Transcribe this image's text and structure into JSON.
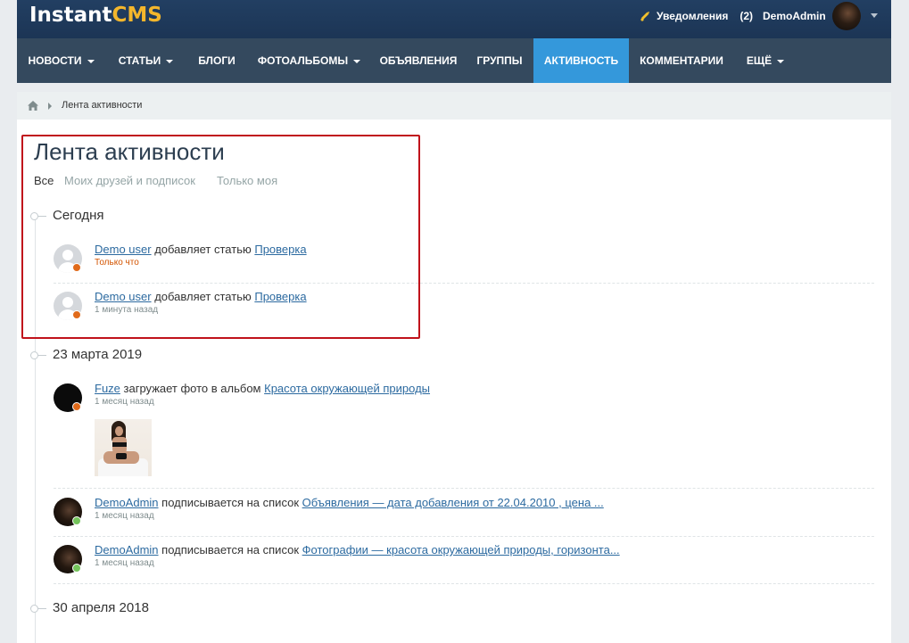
{
  "header": {
    "logo_main": "Instant",
    "logo_accent": "CMS",
    "notifications_label": "Уведомления",
    "notifications_count": "(2)",
    "username": "DemoAdmin"
  },
  "nav": [
    {
      "label": "НОВОСТИ",
      "dropdown": true,
      "active": false
    },
    {
      "label": "СТАТЬИ",
      "dropdown": true,
      "active": false
    },
    {
      "label": "БЛОГИ",
      "dropdown": false,
      "active": false
    },
    {
      "label": "ФОТОАЛЬБОМЫ",
      "dropdown": true,
      "active": false
    },
    {
      "label": "ОБЪЯВЛЕНИЯ",
      "dropdown": false,
      "active": false
    },
    {
      "label": "ГРУППЫ",
      "dropdown": false,
      "active": false
    },
    {
      "label": "АКТИВНОСТЬ",
      "dropdown": false,
      "active": true
    },
    {
      "label": "КОММЕНТАРИИ",
      "dropdown": false,
      "active": false
    },
    {
      "label": "ЕЩЁ",
      "dropdown": true,
      "active": false
    }
  ],
  "breadcrumb": {
    "current": "Лента активности"
  },
  "page": {
    "title": "Лента активности",
    "filters": [
      {
        "label": "Все",
        "active": true
      },
      {
        "label": "Моих друзей и подписок",
        "active": false
      },
      {
        "label": "Только моя",
        "active": false
      }
    ]
  },
  "feed": [
    {
      "day": "Сегодня",
      "entries": [
        {
          "user": "Demo user",
          "action": "добавляет статью",
          "target": "Проверка",
          "time": "Только что",
          "avatar": "default",
          "status": "offline",
          "recent": true
        },
        {
          "user": "Demo user",
          "action": "добавляет статью",
          "target": "Проверка",
          "time": "1 минута назад",
          "avatar": "default",
          "status": "offline",
          "recent": false
        }
      ]
    },
    {
      "day": "23 марта 2019",
      "entries": [
        {
          "user": "Fuze",
          "action": "загружает фото в альбом",
          "target": "Красота окружающей природы",
          "time": "1 месяц назад",
          "avatar": "black",
          "status": "offline",
          "recent": false,
          "photo": true
        },
        {
          "user": "DemoAdmin",
          "action": "подписывается на список",
          "target": "Объявления — дата добавления от 22.04.2010 , цена ...",
          "time": "1 месяц назад",
          "avatar": "dark",
          "status": "online",
          "recent": false
        },
        {
          "user": "DemoAdmin",
          "action": "подписывается на список",
          "target": "Фотографии — красота окружающей природы, горизонта...",
          "time": "1 месяц назад",
          "avatar": "dark",
          "status": "online",
          "recent": false
        }
      ]
    },
    {
      "day": "30 апреля 2018",
      "entries": []
    }
  ],
  "colors": {
    "header_bg": "#1f3a5b",
    "nav_bg": "#34495e",
    "nav_active": "#3498db",
    "logo_accent": "#f3b62c",
    "link": "#2c6aa0",
    "highlight_border": "#c0121b"
  }
}
